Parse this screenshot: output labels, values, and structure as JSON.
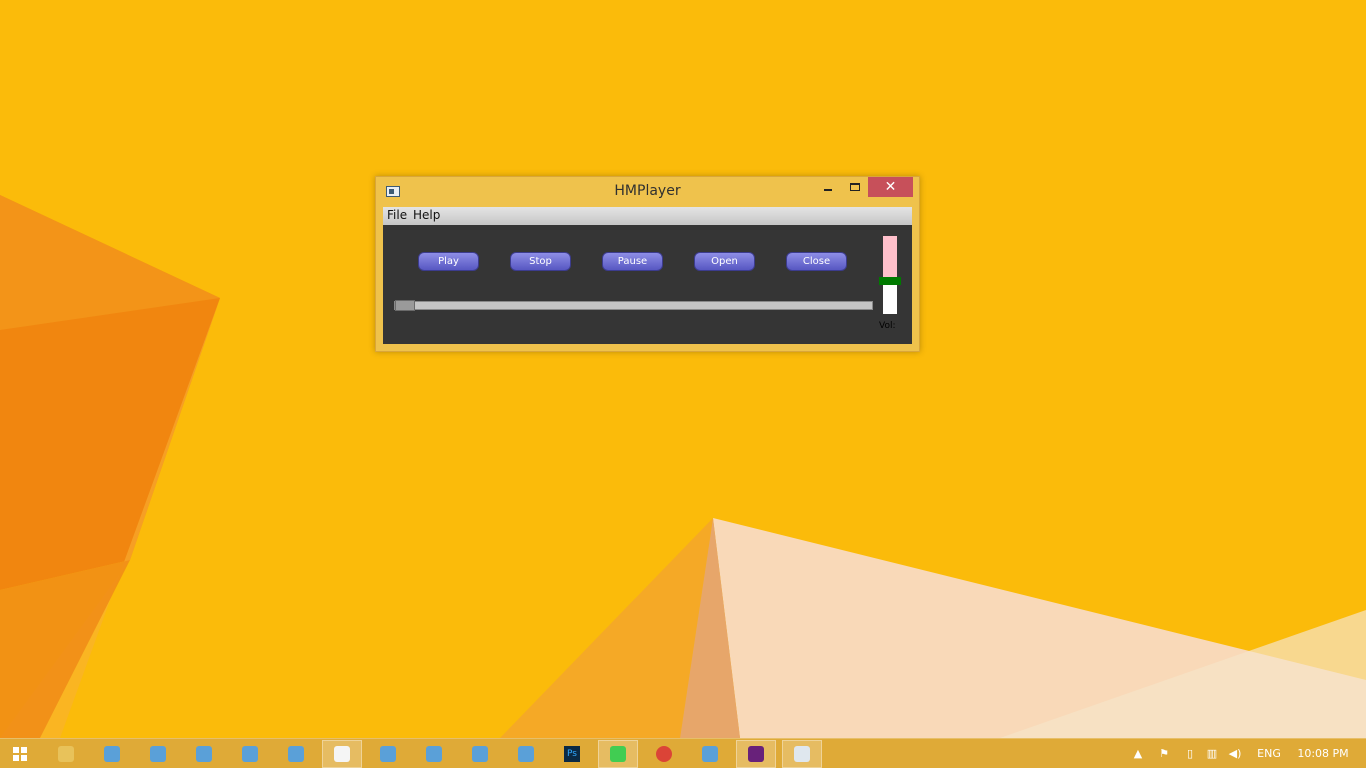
{
  "window": {
    "title": "HMPlayer",
    "close_glyph": "✕",
    "menu": {
      "file": "File",
      "help": "Help"
    },
    "buttons": {
      "play": "Play",
      "stop": "Stop",
      "pause": "Pause",
      "open": "Open",
      "close": "Close"
    },
    "seek": {
      "position": 0.0
    },
    "volume": {
      "label": "Vol:",
      "level": 0.42
    },
    "colors": {
      "titlebar": "#efc24c",
      "close_button": "#c7505a",
      "client_background": "#353535",
      "button": "#6b6bd1",
      "volume_fill": "#ffc0cb",
      "volume_handle": "#007a00"
    }
  },
  "taskbar": {
    "apps": [
      {
        "name": "start-icon",
        "active": false
      },
      {
        "name": "file-explorer-icon",
        "active": false
      },
      {
        "name": "app-icon",
        "active": false
      },
      {
        "name": "app-icon",
        "active": false
      },
      {
        "name": "app-icon",
        "active": false
      },
      {
        "name": "app-icon",
        "active": false
      },
      {
        "name": "app-icon",
        "active": false
      },
      {
        "name": "notepad-icon",
        "active": true
      },
      {
        "name": "app-icon",
        "active": false
      },
      {
        "name": "app-icon",
        "active": false
      },
      {
        "name": "app-icon",
        "active": false
      },
      {
        "name": "app-icon",
        "active": false
      },
      {
        "name": "photoshop-icon",
        "active": false
      },
      {
        "name": "qt-creator-icon",
        "active": true
      },
      {
        "name": "chrome-icon",
        "active": false
      },
      {
        "name": "app-icon",
        "active": false
      },
      {
        "name": "visual-studio-icon",
        "active": true
      },
      {
        "name": "hmplayer-icon",
        "active": true
      }
    ],
    "photoshop_label": "Ps",
    "tray": {
      "language": "ENG",
      "time": "10:08 PM"
    }
  },
  "colors": {
    "desktop": "#fbbb0a",
    "taskbar": "#dca83c"
  }
}
